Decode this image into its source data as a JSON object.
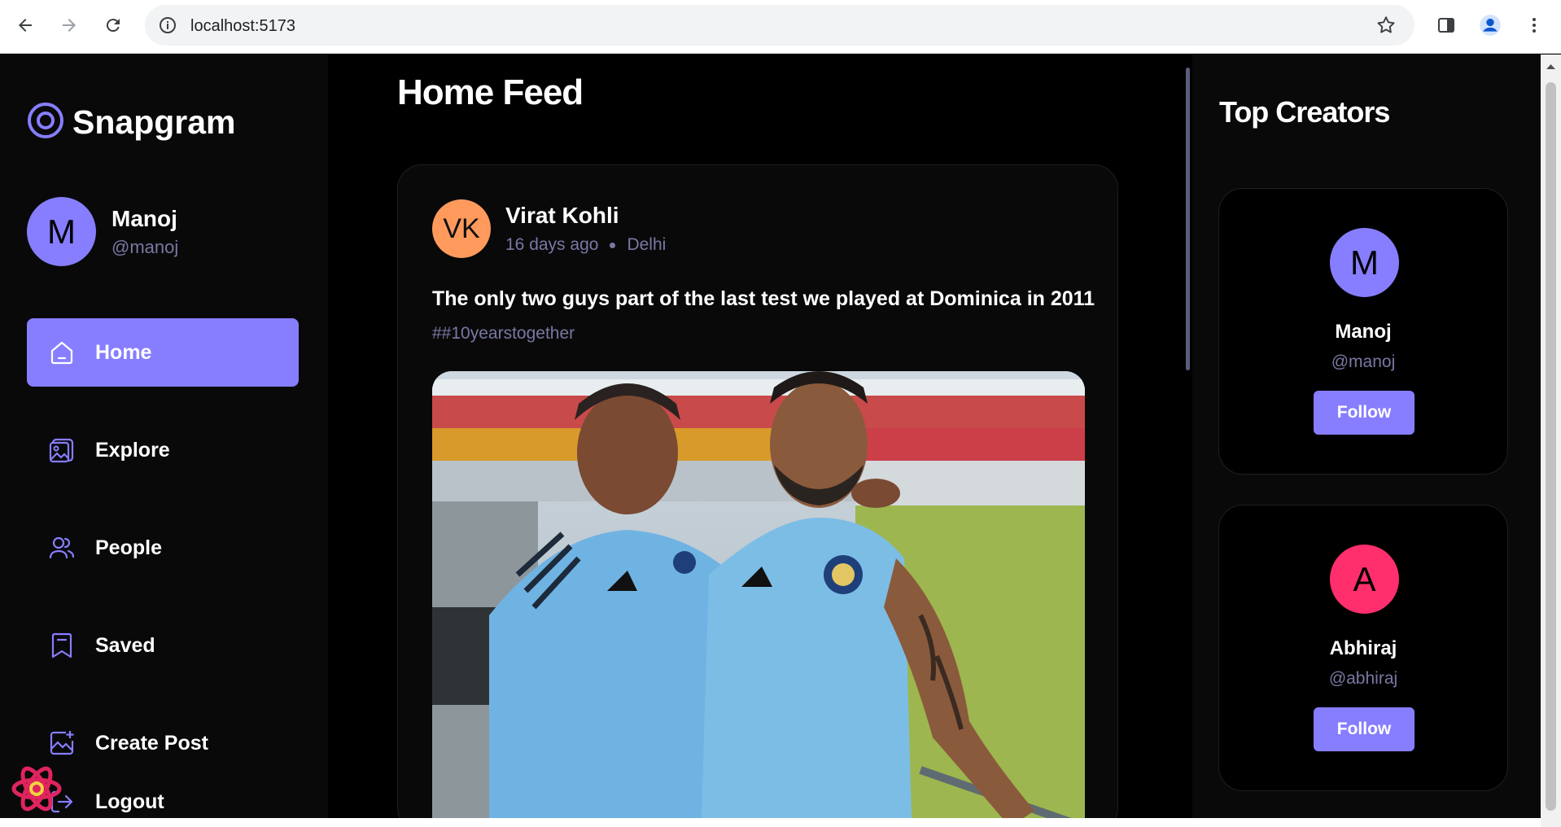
{
  "browser": {
    "url": "localhost:5173"
  },
  "app": {
    "brand": "Snapgram",
    "user": {
      "initial": "M",
      "name": "Manoj",
      "handle": "@manoj"
    },
    "nav": [
      {
        "label": "Home",
        "icon": "home-icon",
        "active": true
      },
      {
        "label": "Explore",
        "icon": "explore-icon",
        "active": false
      },
      {
        "label": "People",
        "icon": "people-icon",
        "active": false
      },
      {
        "label": "Saved",
        "icon": "bookmark-icon",
        "active": false
      },
      {
        "label": "Create Post",
        "icon": "create-post-icon",
        "active": false
      }
    ],
    "logout_label": "Logout"
  },
  "feed": {
    "title": "Home Feed",
    "post": {
      "author_initials": "VK",
      "author": "Virat Kohli",
      "time": "16 days ago",
      "location": "Delhi",
      "caption": "The only two guys part of the last test we played at Dominica in 2011",
      "tags": "##10yearstogether"
    }
  },
  "top_creators": {
    "title": "Top Creators",
    "follow_label": "Follow",
    "creators": [
      {
        "initial": "M",
        "name": "Manoj",
        "handle": "@manoj",
        "color": "#877eff"
      },
      {
        "initial": "A",
        "name": "Abhiraj",
        "handle": "@abhiraj",
        "color": "#ff2e6c"
      }
    ]
  },
  "colors": {
    "accent": "#877eff",
    "muted": "#7878a3",
    "background": "#000000",
    "panel": "#09090a"
  }
}
